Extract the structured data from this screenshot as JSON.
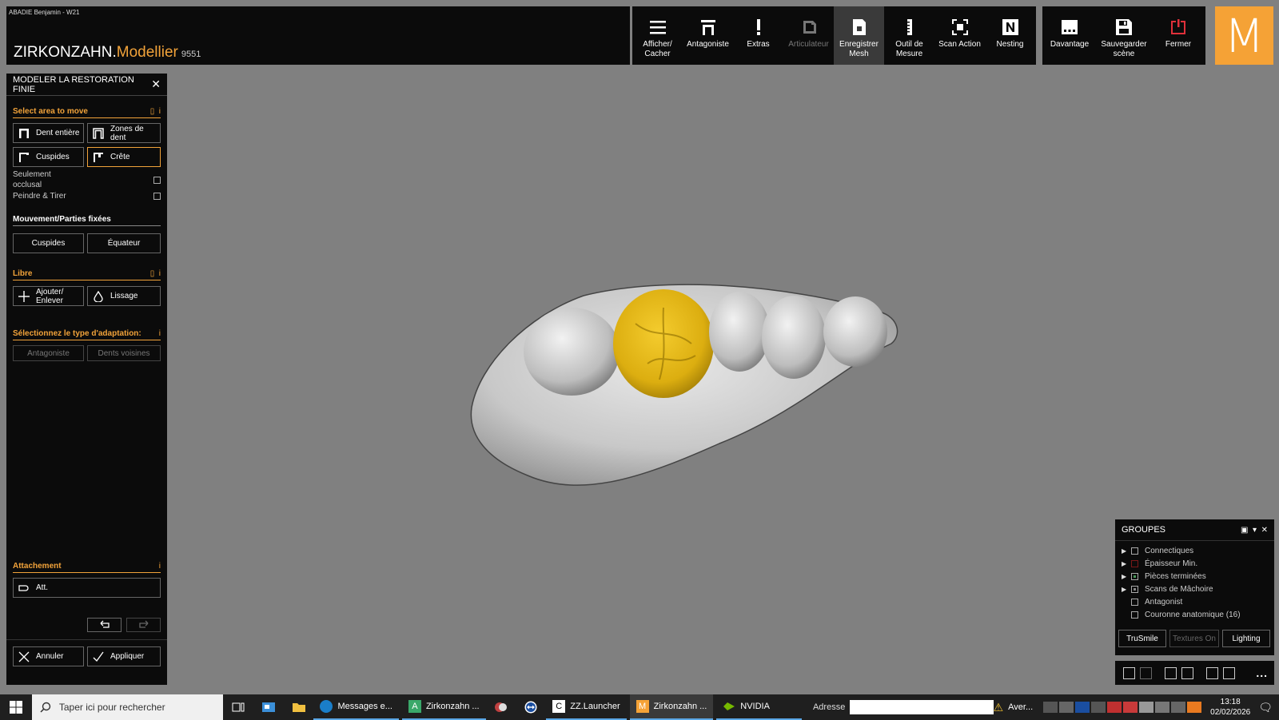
{
  "window": {
    "user": "ABADIE Benjamin - W21",
    "title_brand": "ZIRKONZAHN.",
    "title_module": "Modellier",
    "version": "9551"
  },
  "toolbar": {
    "items": [
      {
        "label": "Afficher/ Cacher",
        "icon": "menu-icon",
        "state": "normal"
      },
      {
        "label": "Antagoniste",
        "icon": "antagonist-icon",
        "state": "normal"
      },
      {
        "label": "Extras",
        "icon": "exclamation-icon",
        "state": "normal"
      },
      {
        "label": "Articulateur",
        "icon": "articulator-icon",
        "state": "disabled"
      },
      {
        "label": "Enregistrer Mesh",
        "icon": "save-mesh-icon",
        "state": "active"
      },
      {
        "label": "Outil de Mesure",
        "icon": "ruler-icon",
        "state": "normal"
      },
      {
        "label": "Scan Action",
        "icon": "scan-icon",
        "state": "normal"
      },
      {
        "label": "Nesting",
        "icon": "nesting-icon",
        "state": "normal"
      }
    ],
    "right_items": [
      {
        "label": "Davantage",
        "icon": "more-icon"
      },
      {
        "label": "Sauvegarder scène",
        "icon": "floppy-icon"
      },
      {
        "label": "Fermer",
        "icon": "power-icon"
      }
    ],
    "logo_letter": "M"
  },
  "panel": {
    "title": "MODELER LA RESTORATION FINIE",
    "select_area": {
      "title": "Select area to move",
      "buttons": [
        "Dent entière",
        "Zones de dent",
        "Cuspides",
        "Crête"
      ],
      "opt_occlusal": "Seulement occlusal",
      "opt_paint": "Peindre & Tirer"
    },
    "movement": {
      "title": "Mouvement/Parties fixées",
      "buttons": [
        "Cuspides",
        "Équateur"
      ]
    },
    "free": {
      "title": "Libre",
      "buttons": [
        "Ajouter/ Enlever",
        "Lissage"
      ]
    },
    "adaptation": {
      "title": "Sélectionnez le type d'adaptation:",
      "buttons": [
        "Antagoniste",
        "Dents voisines"
      ]
    },
    "attachment": {
      "title": "Attachement",
      "button": "Att."
    },
    "footer": {
      "cancel": "Annuler",
      "apply": "Appliquer"
    },
    "info_glyph": "i"
  },
  "groups": {
    "title": "GROUPES",
    "items": [
      {
        "label": "Connectiques",
        "arrow": true,
        "box": "empty"
      },
      {
        "label": "Épaisseur Min.",
        "arrow": true,
        "box": "red"
      },
      {
        "label": "Pièces terminées",
        "arrow": true,
        "box": "part"
      },
      {
        "label": "Scans de Mâchoire",
        "arrow": true,
        "box": "dot"
      },
      {
        "label": "Antagonist",
        "arrow": false,
        "box": "empty"
      },
      {
        "label": "Couronne anatomique (16)",
        "arrow": false,
        "box": "empty"
      }
    ],
    "buttons": [
      "TruSmile",
      "Textures On",
      "Lighting"
    ],
    "more": "..."
  },
  "taskbar": {
    "search_placeholder": "Taper ici pour rechercher",
    "apps": [
      "Messages e...",
      "Zirkonzahn ...",
      "ZZ.Launcher",
      "Zirkonzahn ...",
      "NVIDIA"
    ],
    "address_label": "Adresse",
    "warning": "Aver...",
    "time": "13:18",
    "date": "02/02/2026"
  },
  "colors": {
    "accent": "#f2a33a",
    "crown": "#e2b416",
    "viewport": "#808080"
  }
}
